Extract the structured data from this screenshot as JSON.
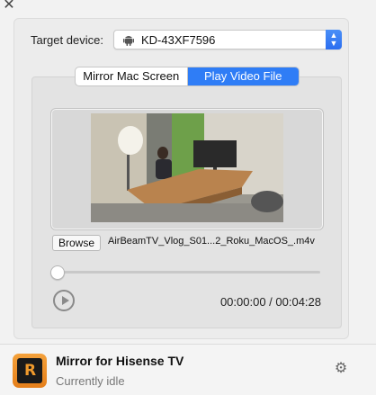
{
  "window": {
    "close_glyph": "✕"
  },
  "target": {
    "label": "Target device:",
    "device": "KD-43XF7596",
    "device_icon": "android-icon"
  },
  "tabs": [
    {
      "label": "Mirror Mac Screen",
      "active": false
    },
    {
      "label": "Play Video File",
      "active": true
    }
  ],
  "player": {
    "browse_label": "Browse",
    "filename": "AirBeamTV_Vlog_S01...2_Roku_MacOS_.m4v",
    "position_fraction": 0.0,
    "time": "00:00:00 / 00:04:28"
  },
  "footer": {
    "app_name": "Mirror for Hisense TV",
    "status": "Currently idle",
    "logo_text": "R",
    "settings_icon": "gear-icon"
  },
  "colors": {
    "accent": "#2f7df6",
    "logo_orange": "#e57f1a"
  }
}
